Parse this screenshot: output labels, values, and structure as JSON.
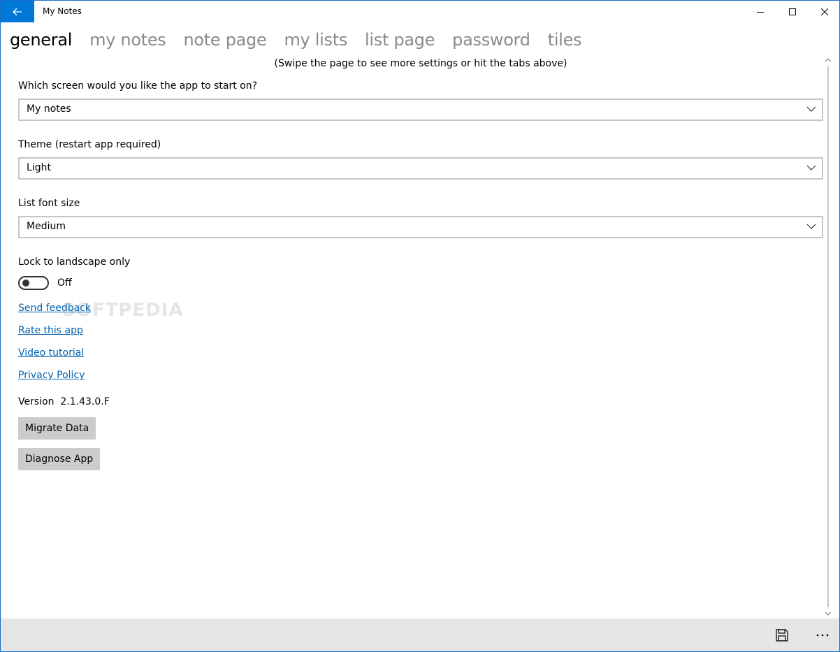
{
  "window": {
    "title": "My Notes"
  },
  "tabs": [
    {
      "label": "general"
    },
    {
      "label": "my notes"
    },
    {
      "label": "note page"
    },
    {
      "label": "my lists"
    },
    {
      "label": "list page"
    },
    {
      "label": "password"
    },
    {
      "label": "tiles"
    }
  ],
  "hint": "(Swipe the page to see more settings or hit the tabs above)",
  "settings": {
    "start_screen": {
      "label": "Which screen would you like the app to start on?",
      "value": "My notes"
    },
    "theme": {
      "label": "Theme (restart app required)",
      "value": "Light"
    },
    "font_size": {
      "label": "List font size",
      "value": "Medium"
    },
    "landscape": {
      "label": "Lock to landscape only",
      "state": "Off"
    }
  },
  "links": {
    "feedback": "Send feedback",
    "rate": "Rate this app",
    "tutorial": "Video tutorial",
    "privacy": "Privacy Policy"
  },
  "version": "Version  2.1.43.0.F",
  "buttons": {
    "migrate": "Migrate Data",
    "diagnose": "Diagnose App"
  },
  "watermark": "SOFTPEDIA",
  "colors": {
    "accent": "#0078d7",
    "link": "#0063b1",
    "appbar": "#e6e6e6",
    "button": "#cccccc"
  },
  "icons": {
    "back": "arrow-left-icon",
    "save": "floppy-disk-icon",
    "more": "ellipsis-icon"
  }
}
